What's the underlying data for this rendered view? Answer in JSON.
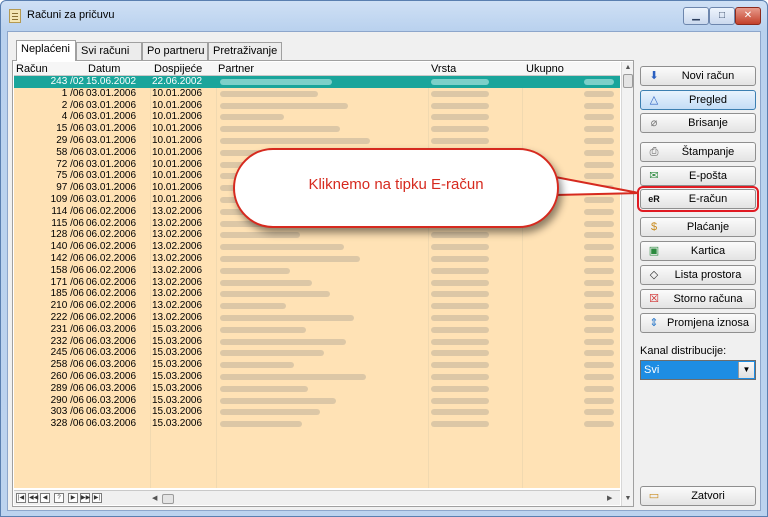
{
  "window": {
    "title": "Računi za pričuvu"
  },
  "tabs": [
    "Neplaćeni",
    "Svi računi",
    "Po partneru",
    "Pretraživanje"
  ],
  "columns": [
    "Račun",
    "Datum",
    "Dospijeće",
    "Partner",
    "Vrsta",
    "Ukupno"
  ],
  "rows": [
    {
      "racun": "243 /02",
      "datum": "15.06.2002",
      "dospijece": "22.06.2002",
      "selected": true
    },
    {
      "racun": "1 /06",
      "datum": "03.01.2006",
      "dospijece": "10.01.2006"
    },
    {
      "racun": "2 /06",
      "datum": "03.01.2006",
      "dospijece": "10.01.2006"
    },
    {
      "racun": "4 /06",
      "datum": "03.01.2006",
      "dospijece": "10.01.2006"
    },
    {
      "racun": "15 /06",
      "datum": "03.01.2006",
      "dospijece": "10.01.2006"
    },
    {
      "racun": "29 /06",
      "datum": "03.01.2006",
      "dospijece": "10.01.2006"
    },
    {
      "racun": "58 /06",
      "datum": "03.01.2006",
      "dospijece": "10.01.2006"
    },
    {
      "racun": "72 /06",
      "datum": "03.01.2006",
      "dospijece": "10.01.2006"
    },
    {
      "racun": "75 /06",
      "datum": "03.01.2006",
      "dospijece": "10.01.2006"
    },
    {
      "racun": "97 /06",
      "datum": "03.01.2006",
      "dospijece": "10.01.2006"
    },
    {
      "racun": "109 /06",
      "datum": "03.01.2006",
      "dospijece": "10.01.2006"
    },
    {
      "racun": "114 /06",
      "datum": "06.02.2006",
      "dospijece": "13.02.2006"
    },
    {
      "racun": "115 /06",
      "datum": "06.02.2006",
      "dospijece": "13.02.2006"
    },
    {
      "racun": "128 /06",
      "datum": "06.02.2006",
      "dospijece": "13.02.2006"
    },
    {
      "racun": "140 /06",
      "datum": "06.02.2006",
      "dospijece": "13.02.2006"
    },
    {
      "racun": "142 /06",
      "datum": "06.02.2006",
      "dospijece": "13.02.2006"
    },
    {
      "racun": "158 /06",
      "datum": "06.02.2006",
      "dospijece": "13.02.2006"
    },
    {
      "racun": "171 /06",
      "datum": "06.02.2006",
      "dospijece": "13.02.2006"
    },
    {
      "racun": "185 /06",
      "datum": "06.02.2006",
      "dospijece": "13.02.2006"
    },
    {
      "racun": "210 /06",
      "datum": "06.02.2006",
      "dospijece": "13.02.2006"
    },
    {
      "racun": "222 /06",
      "datum": "06.02.2006",
      "dospijece": "13.02.2006"
    },
    {
      "racun": "231 /06",
      "datum": "06.03.2006",
      "dospijece": "15.03.2006"
    },
    {
      "racun": "232 /06",
      "datum": "06.03.2006",
      "dospijece": "15.03.2006"
    },
    {
      "racun": "245 /06",
      "datum": "06.03.2006",
      "dospijece": "15.03.2006"
    },
    {
      "racun": "258 /06",
      "datum": "06.03.2006",
      "dospijece": "15.03.2006"
    },
    {
      "racun": "260 /06",
      "datum": "06.03.2006",
      "dospijece": "15.03.2006"
    },
    {
      "racun": "289 /06",
      "datum": "06.03.2006",
      "dospijece": "15.03.2006"
    },
    {
      "racun": "290 /06",
      "datum": "06.03.2006",
      "dospijece": "15.03.2006"
    },
    {
      "racun": "303 /06",
      "datum": "06.03.2006",
      "dospijece": "15.03.2006"
    },
    {
      "racun": "328 /06",
      "datum": "06.03.2006",
      "dospijece": "15.03.2006"
    }
  ],
  "buttons": {
    "novi": "Novi račun",
    "pregled": "Pregled",
    "brisanje": "Brisanje",
    "stampanje": "Štampanje",
    "eposta": "E-pošta",
    "eracun": "E-račun",
    "placanje": "Plaćanje",
    "kartica": "Kartica",
    "lista": "Lista prostora",
    "storno": "Storno računa",
    "promjena": "Promjena iznosa",
    "zatvori": "Zatvori"
  },
  "kanal": {
    "label": "Kanal distribucije:",
    "value": "Svi"
  },
  "callout": "Kliknemo na tipku E-račun"
}
